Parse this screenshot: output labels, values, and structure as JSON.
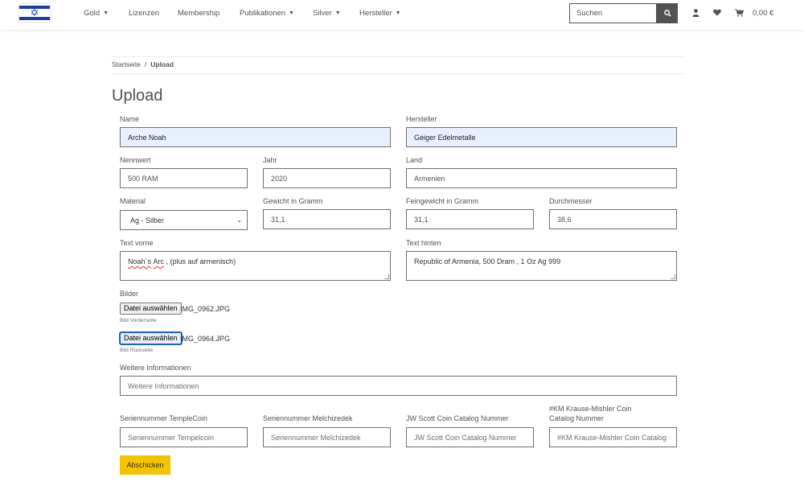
{
  "header": {
    "nav": [
      {
        "label": "Gold",
        "has_dropdown": true
      },
      {
        "label": "Lizenzen",
        "has_dropdown": false
      },
      {
        "label": "Membership",
        "has_dropdown": false
      },
      {
        "label": "Publikationen",
        "has_dropdown": true
      },
      {
        "label": "Silver",
        "has_dropdown": true
      },
      {
        "label": "Hersteller",
        "has_dropdown": true
      }
    ],
    "search_placeholder": "Suchen",
    "cart_total": "0,00 €",
    "icons": [
      "search-icon",
      "user-icon",
      "heart-icon",
      "cart-icon"
    ],
    "colors": {
      "accent": "#f5c400",
      "flag_blue": "#1b3fa0",
      "text": "#525252"
    }
  },
  "breadcrumb": {
    "home": "Startseite",
    "separator": "/",
    "current": "Upload"
  },
  "page_title": "Upload",
  "form": {
    "name": {
      "label": "Name",
      "value": "Arche Noah"
    },
    "hersteller": {
      "label": "Hersteller",
      "value": "Geiger Edelmetalle"
    },
    "nennwert": {
      "label": "Nennwert",
      "value": "500 RAM"
    },
    "jahr": {
      "label": "Jahr",
      "value": "2020"
    },
    "land": {
      "label": "Land",
      "value": "Armenien"
    },
    "material": {
      "label": "Material",
      "value": "Ag - Silber"
    },
    "gewicht": {
      "label": "Gewicht in Gramm",
      "value": "31,1"
    },
    "feingewicht": {
      "label": "Feingewicht in Gramm",
      "value": "31,1"
    },
    "durchmesser": {
      "label": "Durchmesser",
      "value": "38,6"
    },
    "text_vorne": {
      "label": "Text vorne",
      "value_word1": "Noah´s",
      "value_word2": "Arc",
      "value_rest": " , (plus auf armenisch)"
    },
    "text_hinten": {
      "label": "Text hinten",
      "value": "Republic of Armenia, 500 Dram , 1 Oz Ag 999"
    },
    "bilder": {
      "label": "Bilder",
      "front": {
        "button": "Datei auswählen",
        "file": "IMG_0962.JPG",
        "hint": "Bild Vorderseite"
      },
      "back": {
        "button": "Datei auswählen",
        "file": "IMG_0964.JPG",
        "hint": "Bild Rückseite"
      }
    },
    "weitere": {
      "label": "Weitere Informationen",
      "placeholder": "Weitere Informationen"
    },
    "templecoin": {
      "label": "Seriennummer TempleCoin",
      "placeholder": "Seriennummer Tempelcoin"
    },
    "melchizedek": {
      "label": "Seriennummer Melchizedek",
      "placeholder": "Seriennummer Melchizedek"
    },
    "jw_scott": {
      "label": "JW Scott Coin Catalog Nummer",
      "placeholder": "JW Scott Coin Catalog Nummer"
    },
    "krause": {
      "label": "#KM Krause-Mishler Coin Catalog Nummer",
      "placeholder": "#KM Krause-Mishler Coin Catalog Nummer"
    },
    "submit": "Abschicken"
  }
}
